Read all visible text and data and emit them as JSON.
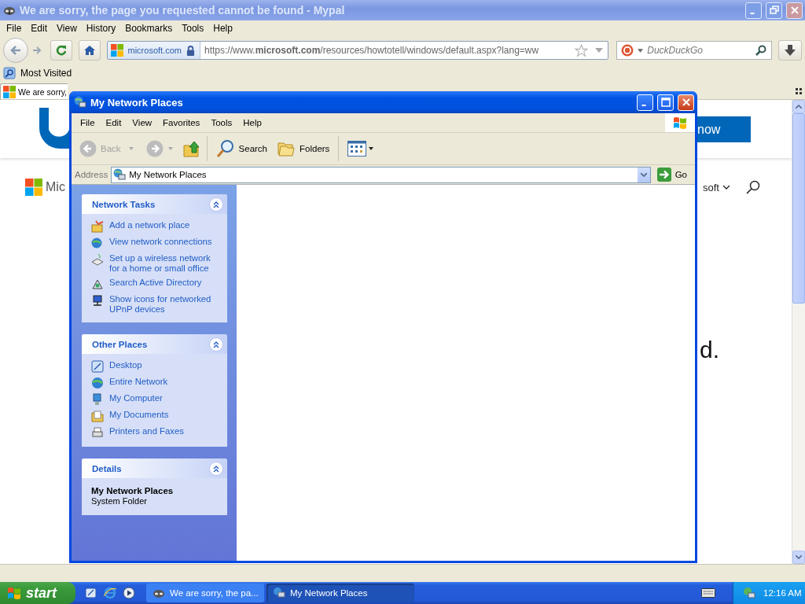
{
  "browser": {
    "title": "We are sorry, the page you requested cannot be found - Mypal",
    "menu": [
      "File",
      "Edit",
      "View",
      "History",
      "Bookmarks",
      "Tools",
      "Help"
    ],
    "site_identity": "microsoft.com",
    "url": "https://www.**microsoft.com**/resources/howtotell/windows/default.aspx?lang=ww",
    "search": {
      "placeholder": "DuckDuckGo"
    },
    "bookmarks": [
      "Most Visited"
    ],
    "tabs": [
      {
        "label": "We are sorry,",
        "selected": true
      }
    ],
    "page": {
      "button": "now",
      "brand": "Mic",
      "nav_item": "soft",
      "heading": "d."
    }
  },
  "explorer": {
    "title": "My Network Places",
    "menu": [
      "File",
      "Edit",
      "View",
      "Favorites",
      "Tools",
      "Help"
    ],
    "toolbar": {
      "back": {
        "label": "Back",
        "disabled": true
      },
      "search": "Search",
      "folders": "Folders"
    },
    "address": {
      "label": "Address",
      "value": "My Network Places",
      "go": "Go"
    },
    "panels": [
      {
        "title": "Network Tasks",
        "expanded": true,
        "kind": "links",
        "items": [
          "Add a network place",
          "View network connections",
          "Set up a wireless network for a home or small office",
          "Search Active Directory",
          "Show icons for networked UPnP devices"
        ]
      },
      {
        "title": "Other Places",
        "expanded": true,
        "kind": "links",
        "items": [
          "Desktop",
          "Entire Network",
          "My Computer",
          "My Documents",
          "Printers and Faxes"
        ]
      },
      {
        "title": "Details",
        "expanded": true,
        "kind": "details",
        "name": "My Network Places",
        "type": "System Folder"
      }
    ]
  },
  "taskbar": {
    "start": "start",
    "buttons": [
      {
        "label": "We are sorry, the pa...",
        "selected": false
      },
      {
        "label": "My Network Places",
        "selected": true
      }
    ],
    "clock": "12:16 AM"
  }
}
